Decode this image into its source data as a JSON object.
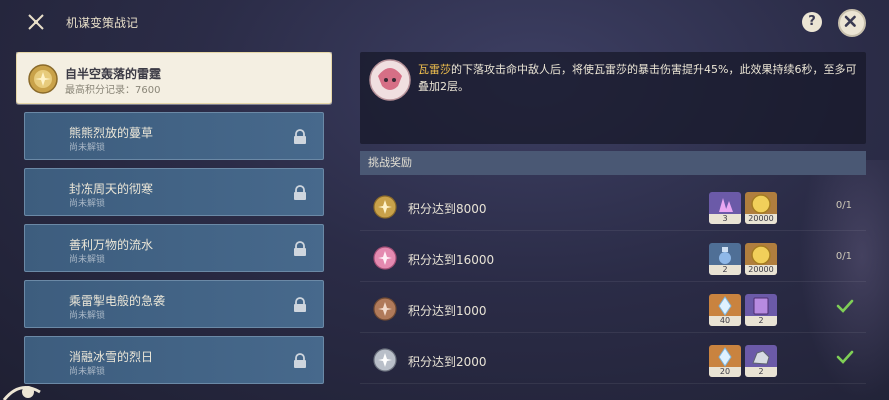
{
  "header": {
    "title": "机谋变策战记",
    "help_label": "?"
  },
  "challenges": [
    {
      "name": "自半空轰落的雷霆",
      "sub": "最高积分记录：7600",
      "state": "active"
    },
    {
      "name": "熊熊烈放的蔓草",
      "sub": "尚未解锁",
      "state": "locked"
    },
    {
      "name": "封冻周天的彻寒",
      "sub": "尚未解锁",
      "state": "locked"
    },
    {
      "name": "善利万物的流水",
      "sub": "尚未解锁",
      "state": "locked"
    },
    {
      "name": "乘雷掣电般的急袭",
      "sub": "尚未解锁",
      "state": "locked"
    },
    {
      "name": "消融冰雪的烈日",
      "sub": "尚未解锁",
      "state": "locked"
    }
  ],
  "description": {
    "character": "瓦雷莎",
    "text": "的下落攻击命中敌人后，将使瓦雷莎的暴击伤害提升45%，此效果持续6秒，至多可叠加2层。"
  },
  "rewards": {
    "header": "挑战奖励",
    "rows": [
      {
        "label": "积分达到8000",
        "medal": "gold",
        "items": [
          {
            "kind": "purple",
            "icon": "crystal-icon",
            "count": "3"
          },
          {
            "kind": "gold",
            "icon": "mora-coin-icon",
            "count": "20000"
          }
        ],
        "progress": "0/1",
        "done": false
      },
      {
        "label": "积分达到16000",
        "medal": "pink",
        "items": [
          {
            "kind": "blue",
            "icon": "potion-icon",
            "count": "2"
          },
          {
            "kind": "gold",
            "icon": "mora-coin-icon",
            "count": "20000"
          }
        ],
        "progress": "0/1",
        "done": false
      },
      {
        "label": "积分达到1000",
        "medal": "bronze",
        "items": [
          {
            "kind": "orange",
            "icon": "primogem-icon",
            "count": "40"
          },
          {
            "kind": "purple",
            "icon": "book-icon",
            "count": "2"
          }
        ],
        "progress": "",
        "done": true
      },
      {
        "label": "积分达到2000",
        "medal": "silver",
        "items": [
          {
            "kind": "orange",
            "icon": "primogem-icon",
            "count": "20"
          },
          {
            "kind": "purple",
            "icon": "ore-icon",
            "count": "2"
          }
        ],
        "progress": "",
        "done": true
      }
    ]
  },
  "colors": {
    "accent_gold": "#f2c14e",
    "check_green": "#7fcf56",
    "locked_blue": "#47698c"
  }
}
